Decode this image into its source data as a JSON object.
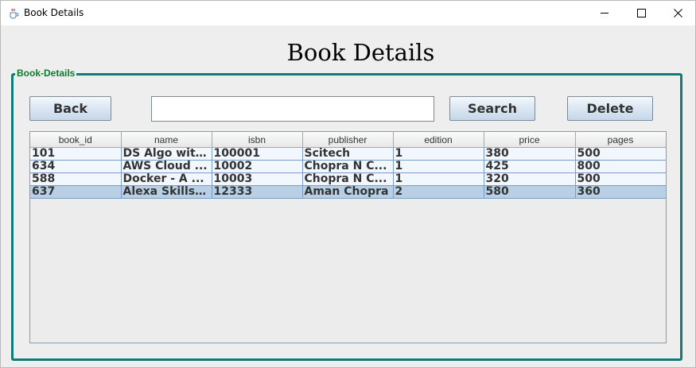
{
  "window": {
    "title": "Book Details",
    "icon": "java-cup-icon",
    "controls": [
      "minimize",
      "maximize",
      "close"
    ]
  },
  "heading": "Book Details",
  "group": {
    "legend": "Book-Details"
  },
  "toolbar": {
    "back_label": "Back",
    "search_value": "",
    "search_label": "Search",
    "delete_label": "Delete"
  },
  "table": {
    "columns": [
      "book_id",
      "name",
      "isbn",
      "publisher",
      "edition",
      "price",
      "pages"
    ],
    "rows": [
      [
        "101",
        "DS Algo with C",
        "100001",
        "Scitech",
        "1",
        "380",
        "500"
      ],
      [
        "634",
        "AWS Cloud ...",
        "10002",
        "Chopra N C...",
        "1",
        "425",
        "800"
      ],
      [
        "588",
        "Docker - A ...",
        "10003",
        "Chopra N C...",
        "1",
        "320",
        "500"
      ],
      [
        "637",
        "Alexa Skills ...",
        "12333",
        "Aman Chopra",
        "2",
        "580",
        "360"
      ]
    ],
    "selected_row": 3
  },
  "colors": {
    "group_border": "#107c77",
    "legend_text": "#0b7d2b",
    "selected_row": "#b8cfe5"
  }
}
